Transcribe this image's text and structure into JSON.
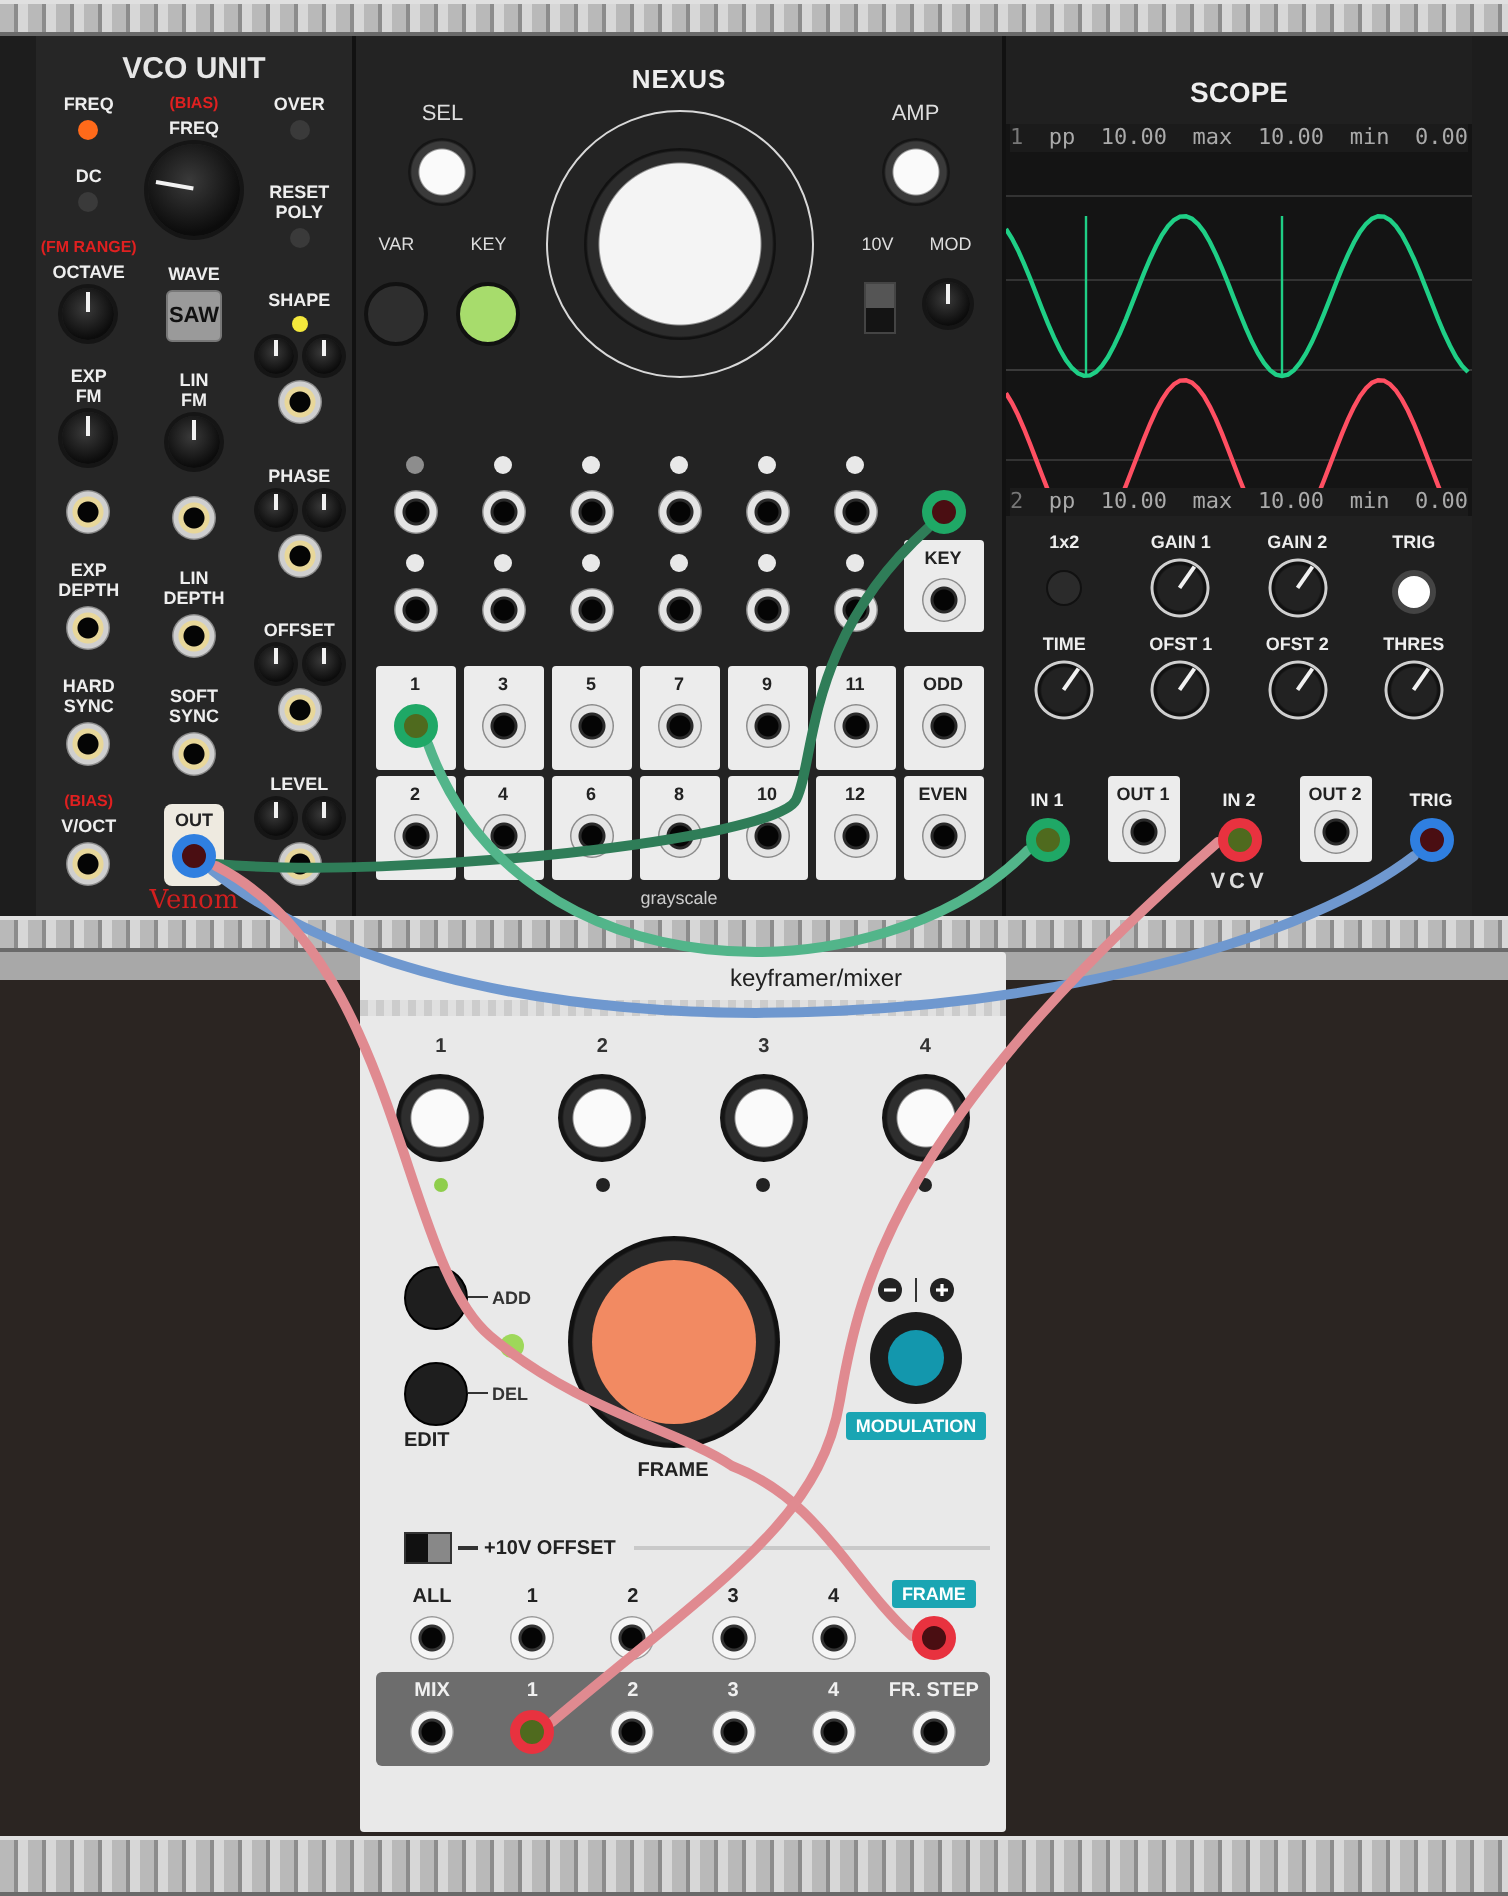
{
  "vco": {
    "title": "VCO UNIT",
    "brand": "Venom",
    "columns": [
      [
        {
          "kind": "led",
          "label": "FREQ",
          "on": true,
          "color": "#ff6a1a"
        },
        {
          "kind": "led",
          "label": "DC",
          "on": false
        },
        {
          "kind": "knob",
          "note": "(FM RANGE)",
          "label": "OCTAVE"
        },
        {
          "kind": "knob",
          "label": "EXP FM"
        },
        {
          "kind": "jack"
        },
        {
          "kind": "jack",
          "label": "EXP DEPTH"
        },
        {
          "kind": "jack",
          "label": "HARD SYNC"
        },
        {
          "kind": "jack",
          "note": "(BIAS)",
          "label": "V/OCT"
        }
      ],
      [
        {
          "kind": "bigknob",
          "note": "(BIAS)",
          "label": "FREQ"
        },
        {
          "kind": "button",
          "label": "WAVE",
          "value": "SAW"
        },
        {
          "kind": "knob",
          "label": "LIN FM"
        },
        {
          "kind": "jack"
        },
        {
          "kind": "jack",
          "label": "LIN DEPTH"
        },
        {
          "kind": "jack",
          "label": "SOFT SYNC"
        },
        {
          "kind": "out",
          "label": "OUT",
          "color": "#2f7fe0"
        }
      ],
      [
        {
          "kind": "led",
          "label": "OVER",
          "on": false
        },
        {
          "kind": "led",
          "label": "RESET POLY",
          "on": false
        },
        {
          "kind": "cv",
          "label": "SHAPE",
          "on": true,
          "color": "#f4e83c"
        },
        {
          "kind": "cv",
          "label": "PHASE"
        },
        {
          "kind": "cv",
          "label": "OFFSET"
        },
        {
          "kind": "cv",
          "label": "LEVEL"
        }
      ]
    ]
  },
  "nexus": {
    "title": "NEXUS",
    "sel": "SEL",
    "amp": "AMP",
    "buttons": [
      {
        "label": "VAR",
        "on": false
      },
      {
        "label": "KEY",
        "on": true
      }
    ],
    "switch": {
      "label": "10V",
      "on": true
    },
    "mod": "MOD",
    "mod_jack": {
      "color": "#1fa866"
    },
    "key_input": "KEY",
    "lights": [
      {
        "on": false
      },
      {
        "on": true
      },
      {
        "on": true
      },
      {
        "on": true
      },
      {
        "on": true
      },
      {
        "on": true
      },
      {
        "on": true
      },
      {
        "on": true
      },
      {
        "on": true
      },
      {
        "on": true
      },
      {
        "on": true
      },
      {
        "on": true
      }
    ],
    "outputs": [
      [
        {
          "label": "1",
          "color": "#1fa866"
        },
        {
          "label": "3"
        },
        {
          "label": "5"
        },
        {
          "label": "7"
        },
        {
          "label": "9"
        },
        {
          "label": "11"
        },
        {
          "label": "ODD"
        }
      ],
      [
        {
          "label": "2"
        },
        {
          "label": "4"
        },
        {
          "label": "6"
        },
        {
          "label": "8"
        },
        {
          "label": "10"
        },
        {
          "label": "12"
        },
        {
          "label": "EVEN"
        }
      ]
    ],
    "footer": "grayscale"
  },
  "scope": {
    "title": "SCOPE",
    "readouts": [
      {
        "channel": "1",
        "items": [
          {
            "label": "pp",
            "value": "10.00"
          },
          {
            "label": "max",
            "value": "10.00"
          },
          {
            "label": "min",
            "value": "0.00"
          }
        ]
      },
      {
        "channel": "2",
        "items": [
          {
            "label": "pp",
            "value": "10.00"
          },
          {
            "label": "max",
            "value": "10.00"
          },
          {
            "label": "min",
            "value": "0.00"
          }
        ]
      }
    ],
    "controls": [
      [
        {
          "kind": "button",
          "label": "1x2"
        },
        {
          "kind": "knob",
          "label": "GAIN 1"
        },
        {
          "kind": "knob",
          "label": "GAIN 2"
        },
        {
          "kind": "light",
          "label": "TRIG",
          "on": true
        }
      ],
      [
        {
          "kind": "knob",
          "label": "TIME"
        },
        {
          "kind": "knob",
          "label": "OFST 1"
        },
        {
          "kind": "knob",
          "label": "OFST 2"
        },
        {
          "kind": "knob",
          "label": "THRES"
        }
      ]
    ],
    "ports": [
      {
        "kind": "in",
        "label": "IN 1",
        "color": "#1fa866"
      },
      {
        "kind": "out",
        "label": "OUT 1"
      },
      {
        "kind": "in",
        "label": "IN 2",
        "color": "#e8323f"
      },
      {
        "kind": "out",
        "label": "OUT 2"
      },
      {
        "kind": "in",
        "label": "TRIG",
        "color": "#2f7fe0"
      }
    ],
    "logo": "VCV"
  },
  "keyframer": {
    "title": "keyframer/mixer",
    "channels": [
      {
        "label": "1",
        "on": true
      },
      {
        "label": "2",
        "on": false
      },
      {
        "label": "3",
        "on": false
      },
      {
        "label": "4",
        "on": false
      }
    ],
    "add": "ADD",
    "del": "DEL",
    "edit": "EDIT",
    "edit_light": true,
    "frame": "FRAME",
    "modulation": "MODULATION",
    "offset": {
      "label": "+10V OFFSET",
      "on": false
    },
    "inputs": [
      "ALL",
      "1",
      "2",
      "3",
      "4"
    ],
    "frame_input": {
      "label": "FRAME",
      "color": "#e8323f"
    },
    "outputs": [
      {
        "label": "MIX"
      },
      {
        "label": "1",
        "color": "#e8323f"
      },
      {
        "label": "2"
      },
      {
        "label": "3"
      },
      {
        "label": "4"
      },
      {
        "label": "FR. STEP"
      }
    ]
  },
  "cables": [
    {
      "color": "#2f7d58"
    },
    {
      "color": "#52b58a"
    },
    {
      "color": "#6f98cf"
    },
    {
      "color": "#e08a90"
    },
    {
      "color": "#e08a90"
    }
  ]
}
